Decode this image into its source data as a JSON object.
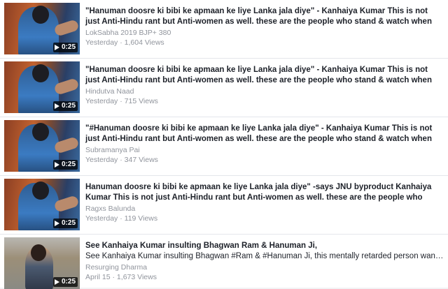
{
  "videos": [
    {
      "title": "\"Hanuman doosre ki bibi ke apmaan ke liye Lanka jala diye\" - Kanhaiya Kumar This is not just Anti-Hindu rant but Anti-women as well. these are the people who stand & watch when women...",
      "description": "",
      "source": "LokSabha 2019 BJP+ 380",
      "meta": "Yesterday · 1,604 Views",
      "duration": "0:25",
      "thumbnail_icon": "video-thumbnail"
    },
    {
      "title": "\"Hanuman doosre ki bibi ke apmaan ke liye Lanka jala diye\" - Kanhaiya Kumar This is not just Anti-Hindu rant but Anti-women as well. these are the people who stand & watch when women...",
      "description": "",
      "source": "Hindutva Naad",
      "meta": "Yesterday · 715 Views",
      "duration": "0:25",
      "thumbnail_icon": "video-thumbnail"
    },
    {
      "title": "\"#Hanuman doosre ki bibi ke apmaan ke liye Lanka jala diye\" - Kanhaiya Kumar This is not just Anti-Hindu rant but Anti-women as well. these are the people who stand & watch when women...",
      "description": "",
      "source": "Subramanya Pai",
      "meta": "Yesterday · 347 Views",
      "duration": "0:25",
      "thumbnail_icon": "video-thumbnail"
    },
    {
      "title": "Hanuman doosre ki bibi ke apmaan ke liye Lanka jala diye\" -says JNU byproduct Kanhaiya Kumar This is not just Anti-Hindu rant but Anti-women as well. these are the people who stand...",
      "description": "",
      "source": "Ragxs Balunda",
      "meta": "Yesterday · 119 Views",
      "duration": "0:25",
      "thumbnail_icon": "video-thumbnail"
    },
    {
      "title": "See Kanhaiya Kumar insulting Bhagwan Ram & Hanuman Ji,",
      "description": "See Kanhaiya Kumar insulting Bhagwan #Ram & #Hanuman Ji, this mentally retarded person wants t...",
      "source": "Resurging Dharma",
      "meta": "April 15 · 1,673 Views",
      "duration": "0:25",
      "thumbnail_icon": "video-thumbnail"
    }
  ],
  "colors": {
    "title": "#1d2129",
    "secondary": "#90949c",
    "divider": "#e4e6eb"
  }
}
